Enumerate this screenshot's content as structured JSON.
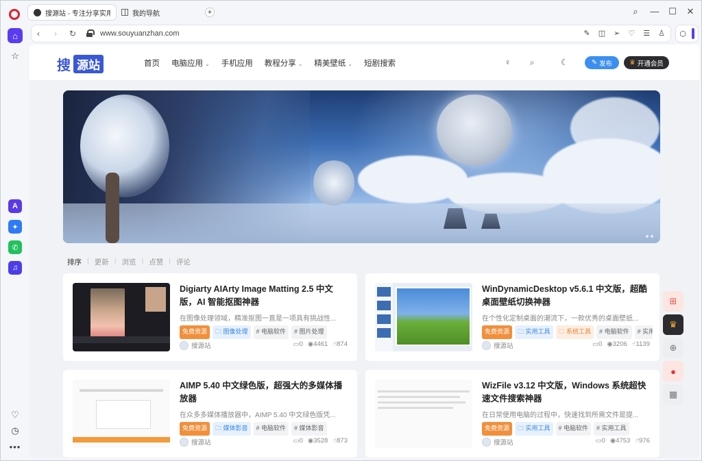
{
  "browser": {
    "tabs": [
      {
        "label": "搜源站 - 专注分享实用软"
      },
      {
        "label": "我的导航"
      }
    ],
    "new_tab": "+",
    "url": "www.souyuanzhan.com",
    "controls": {
      "search": "⌕",
      "minimize": "—",
      "maximize": "☐",
      "close": "✕"
    }
  },
  "sidebar": {
    "icons": [
      "opera-logo",
      "home-icon",
      "bookmark-star-icon",
      "aria-icon",
      "messenger-icon",
      "whatsapp-icon",
      "music-icon",
      "heart-icon",
      "history-icon",
      "more-icon"
    ]
  },
  "site": {
    "logo": {
      "a": "搜",
      "b": "源站"
    },
    "nav": [
      {
        "label": "首页",
        "caret": false
      },
      {
        "label": "电脑应用",
        "caret": true
      },
      {
        "label": "手机应用",
        "caret": false
      },
      {
        "label": "教程分享",
        "caret": true
      },
      {
        "label": "精美壁纸",
        "caret": true
      },
      {
        "label": "短剧搜索",
        "caret": false
      }
    ],
    "publish_label": "发布",
    "vip_label": "开通会员"
  },
  "sort": {
    "label": "排序",
    "options": [
      "更新",
      "浏览",
      "点赞",
      "评论"
    ]
  },
  "articles": [
    {
      "title": "Digiarty AIArty Image Matting 2.5 中文版，AI 智能抠图神器",
      "desc": "在图像处理领域，精准抠图一直是一项具有挑战性...",
      "tags": [
        {
          "text": "免费资源",
          "style": "orange"
        },
        {
          "text": "🗀 图像处理",
          "style": "blue"
        },
        {
          "text": "# 电脑软件",
          "style": "gray"
        },
        {
          "text": "# 图片处理",
          "style": "gray"
        }
      ],
      "author": "搜源站",
      "comments": "0",
      "views": "4461",
      "likes": "874"
    },
    {
      "title": "WinDynamicDesktop v5.6.1 中文版，超酷桌面壁纸切换神器",
      "desc": "在个性化定制桌面的潮流下，一款优秀的桌面壁纸...",
      "tags": [
        {
          "text": "免费资源",
          "style": "orange"
        },
        {
          "text": "🗀 实用工具",
          "style": "blue"
        },
        {
          "text": "🗀 系统工具",
          "style": "peach"
        },
        {
          "text": "# 电脑软件",
          "style": "gray"
        },
        {
          "text": "# 实用工",
          "style": "gray"
        }
      ],
      "author": "搜源站",
      "comments": "0",
      "views": "3206",
      "likes": "1139"
    },
    {
      "title": "AIMP 5.40 中文绿色版，超强大的多媒体播放器",
      "desc": "在众多多媒体播放器中，AIMP 5.40 中文绿色版凭...",
      "tags": [
        {
          "text": "免费资源",
          "style": "orange"
        },
        {
          "text": "🗀 媒体影音",
          "style": "blue"
        },
        {
          "text": "# 电脑软件",
          "style": "gray"
        },
        {
          "text": "# 媒体影音",
          "style": "gray"
        }
      ],
      "author": "搜源站",
      "comments": "0",
      "views": "3528",
      "likes": "873"
    },
    {
      "title": "WizFile v3.12 中文版，Windows 系统超快速文件搜索神器",
      "desc": "在日常使用电脑的过程中，快速找到所需文件是提...",
      "tags": [
        {
          "text": "免费资源",
          "style": "orange"
        },
        {
          "text": "🗀 实用工具",
          "style": "blue"
        },
        {
          "text": "# 电脑软件",
          "style": "gray"
        },
        {
          "text": "# 实用工具",
          "style": "gray"
        }
      ],
      "author": "搜源站",
      "comments": "0",
      "views": "4753",
      "likes": "976"
    }
  ],
  "floating": [
    "gift-icon",
    "vip-crown-icon",
    "add-icon",
    "wechat-icon",
    "qrcode-icon"
  ]
}
